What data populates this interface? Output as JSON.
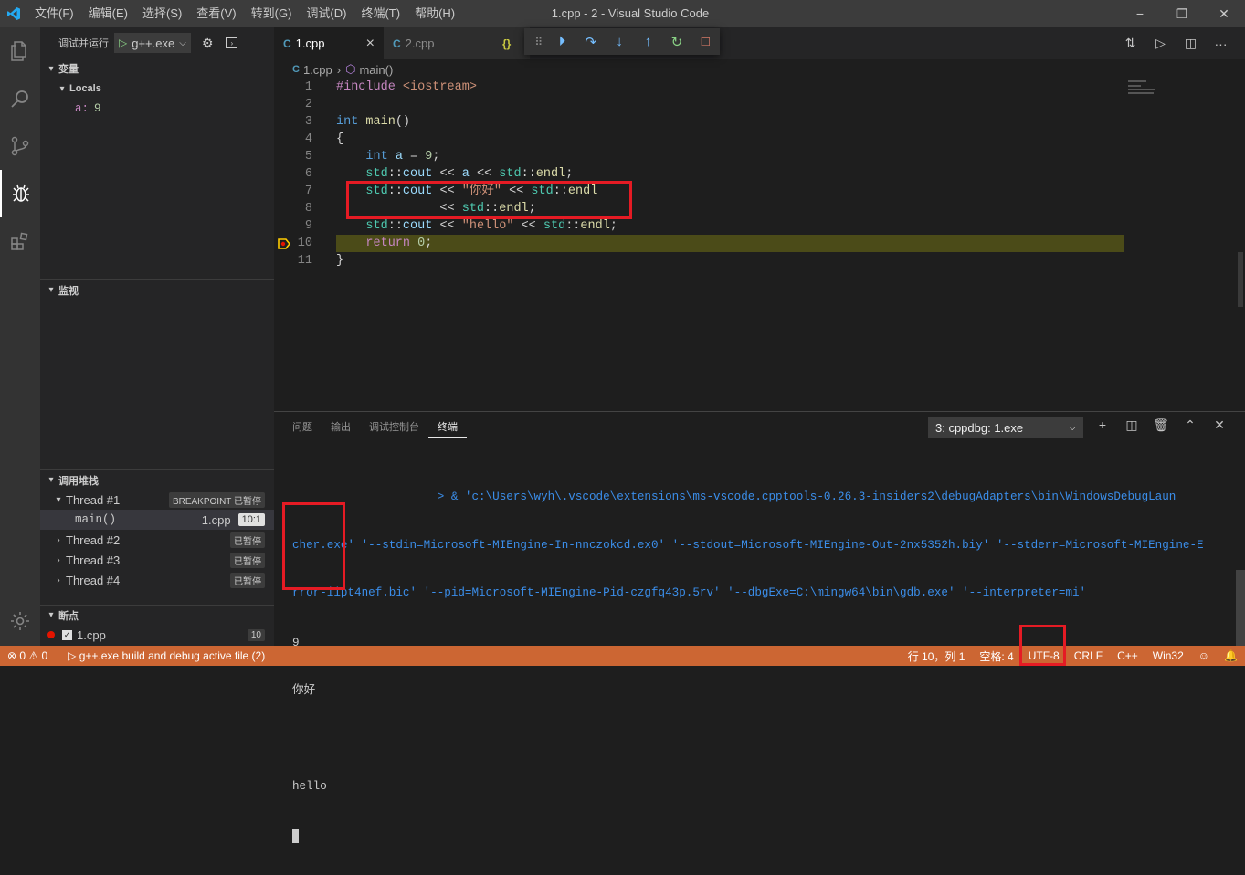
{
  "window": {
    "title": "1.cpp - 2 - Visual Studio Code",
    "menu": [
      "文件(F)",
      "编辑(E)",
      "选择(S)",
      "查看(V)",
      "转到(G)",
      "调试(D)",
      "终端(T)",
      "帮助(H)"
    ],
    "controls": [
      "−",
      "❐",
      "✕"
    ]
  },
  "activity_icons": [
    "explorer-icon",
    "search-icon",
    "source-control-icon",
    "debug-icon",
    "extensions-icon",
    "settings-gear-icon"
  ],
  "sidebar": {
    "debug_label": "调试并运行",
    "config": "g++.exe",
    "variables_title": "变量",
    "locals_label": "Locals",
    "var_name": "a:",
    "var_value": "9",
    "watch_title": "监视",
    "callstack_title": "调用堆栈",
    "threads": [
      {
        "name": "Thread #1",
        "status": "BREAKPOINT 已暂停"
      },
      {
        "name": "Thread #2",
        "status": "已暂停"
      },
      {
        "name": "Thread #3",
        "status": "已暂停"
      },
      {
        "name": "Thread #4",
        "status": "已暂停"
      }
    ],
    "frame": {
      "name": "main()",
      "file": "1.cpp",
      "pos": "10:1"
    },
    "breakpoints_title": "断点",
    "breakpoint_file": "1.cpp",
    "breakpoint_line": "10"
  },
  "tabs": [
    {
      "label": "1.cpp"
    },
    {
      "label": "2.cpp"
    }
  ],
  "tab_close": "×",
  "breadcrumb": {
    "file": "1.cpp",
    "symbol": "main()"
  },
  "code_lines": [
    {
      "n": "1"
    },
    {
      "n": "2"
    },
    {
      "n": "3"
    },
    {
      "n": "4"
    },
    {
      "n": "5"
    },
    {
      "n": "6"
    },
    {
      "n": "7"
    },
    {
      "n": "8"
    },
    {
      "n": "9"
    },
    {
      "n": "10"
    },
    {
      "n": "11"
    }
  ],
  "panel": {
    "tabs": [
      "问题",
      "输出",
      "调试控制台",
      "终端"
    ],
    "terminal_select": "3: cppdbg: 1.exe",
    "terminal_lines": [
      "                     > & 'c:\\Users\\wyh\\.vscode\\extensions\\ms-vscode.cpptools-0.26.3-insiders2\\debugAdapters\\bin\\WindowsDebugLaun",
      "cher.exe' '--stdin=Microsoft-MIEngine-In-nnczokcd.ex0' '--stdout=Microsoft-MIEngine-Out-2nx5352h.biy' '--stderr=Microsoft-MIEngine-E",
      "rror-iipt4nef.bic' '--pid=Microsoft-MIEngine-Pid-czgfq43p.5rv' '--dbgExe=C:\\mingw64\\bin\\gdb.exe' '--interpreter=mi'"
    ],
    "output": [
      "9",
      "你好",
      "",
      "hello"
    ]
  },
  "status": {
    "errors": "⊗ 0 ⚠ 0",
    "launch": "▷ g++.exe build and debug active file (2)",
    "position": "行 10，列 1",
    "spaces": "空格: 4",
    "encoding": "UTF-8",
    "eol": "CRLF",
    "lang": "C++",
    "platform": "Win32"
  },
  "colors": {
    "statusbar": "#cc6633",
    "highlight": "#e51b24",
    "current_line": "#4b4b18"
  }
}
